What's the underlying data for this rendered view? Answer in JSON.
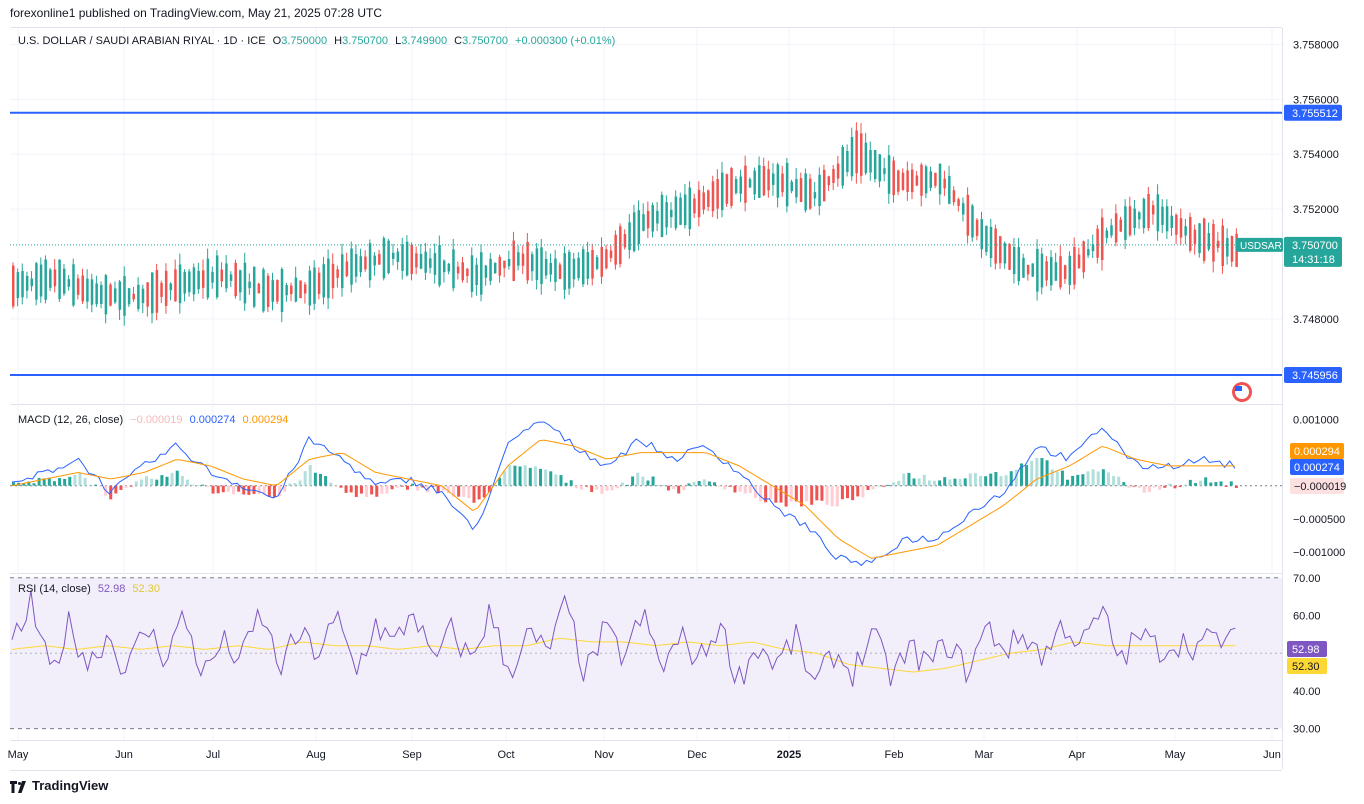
{
  "header": {
    "text": "forexonline1 published on TradingView.com, May 21, 2025 07:28 UTC"
  },
  "legend": {
    "symbol": "U.S. DOLLAR / SAUDI ARABIAN RIYAL · 1D · ICE",
    "o_label": "O",
    "o": "3.750000",
    "h_label": "H",
    "h": "3.750700",
    "l_label": "L",
    "l": "3.749900",
    "c_label": "C",
    "c": "3.750700",
    "change": "+0.000300 (+0.01%)"
  },
  "macd_legend": {
    "label": "MACD (12, 26, close)",
    "hist": "−0.000019",
    "macd": "0.000274",
    "signal": "0.000294"
  },
  "rsi_legend": {
    "label": "RSI (14, close)",
    "rsi": "52.98",
    "ma": "52.30"
  },
  "footer": {
    "brand": "TradingView"
  },
  "colors": {
    "up": "#26a69a",
    "down": "#ef5350",
    "hline": "#2962ff",
    "macd": "#2962ff",
    "signal": "#ff9800",
    "rsi": "#7e57c2",
    "rsi_ma": "#fdd835",
    "rsi_band": "#f2effb"
  },
  "chart_data": [
    {
      "type": "candlestick",
      "title": "U.S. DOLLAR / SAUDI ARABIAN RIYAL · 1D · ICE",
      "ylim": [
        3.7449,
        3.7586
      ],
      "yticks": [
        "3.758000",
        "3.756000",
        "3.754000",
        "3.752000",
        "3.748000"
      ],
      "xticks": [
        "May",
        "Jun",
        "Jul",
        "Aug",
        "Sep",
        "Oct",
        "Nov",
        "Dec",
        "2025",
        "Feb",
        "Mar",
        "Apr",
        "May",
        "Jun"
      ],
      "hlines": [
        {
          "value": 3.755512,
          "label": "3.755512"
        },
        {
          "value": 3.745956,
          "label": "3.745956"
        }
      ],
      "last_price": {
        "symbol": "USDSAR",
        "value": 3.7507,
        "label": "3.750700",
        "countdown": "14:31:18"
      },
      "trend": [
        3.7492,
        3.7495,
        3.7489,
        3.7488,
        3.7493,
        3.7496,
        3.749,
        3.7491,
        3.7499,
        3.7503,
        3.75,
        3.7496,
        3.7502,
        3.7497,
        3.7501,
        3.7516,
        3.752,
        3.7528,
        3.7531,
        3.7525,
        3.7541,
        3.753,
        3.7531,
        3.751,
        3.7498,
        3.7497,
        3.7512,
        3.752,
        3.751,
        3.7505
      ]
    },
    {
      "type": "macd",
      "title": "MACD (12, 26, close)",
      "ylim": [
        -0.00132,
        0.00122
      ],
      "yticks": [
        "0.001000",
        "−0.000500",
        "−0.001000"
      ],
      "macd": 0.000274,
      "signal": 0.000294,
      "histogram": -1.9e-05,
      "macd_trend": [
        0.0,
        0.0002,
        0.0004,
        -0.0001,
        0.0003,
        0.0006,
        0.0002,
        0.0,
        -0.0002,
        0.0007,
        0.0004,
        0.0,
        0.0001,
        -0.0001,
        -0.0007,
        0.0006,
        0.001,
        0.0006,
        0.0003,
        0.0007,
        0.0004,
        0.0006,
        0.0002,
        -0.0003,
        -0.0006,
        -0.0011,
        -0.0012,
        -0.0008,
        -0.0008,
        -0.0004,
        -0.0001,
        0.0006,
        0.0004,
        0.0009,
        0.0003,
        0.0003,
        0.0004,
        0.0003
      ],
      "signal_trend": [
        0.0,
        0.0001,
        0.0002,
        0.0001,
        0.0002,
        0.0004,
        0.0003,
        0.0001,
        0.0,
        0.0004,
        0.0005,
        0.0002,
        0.0001,
        0.0,
        -0.0004,
        0.0003,
        0.0007,
        0.0006,
        0.0004,
        0.0005,
        0.0005,
        0.0005,
        0.0003,
        0.0,
        -0.0003,
        -0.0008,
        -0.0011,
        -0.001,
        -0.0009,
        -0.0006,
        -0.0003,
        0.0001,
        0.0003,
        0.0006,
        0.0004,
        0.0003,
        0.0003,
        0.0003
      ]
    },
    {
      "type": "rsi",
      "title": "RSI (14, close)",
      "ylim": [
        27,
        71
      ],
      "yticks": [
        "70.00",
        "60.00",
        "40.00",
        "30.00"
      ],
      "bands": [
        70,
        30
      ],
      "mid": 50,
      "rsi": 52.98,
      "rsi_ma": 52.3,
      "rsi_trend": [
        52,
        63,
        44,
        58,
        47,
        55,
        45,
        57,
        49,
        60,
        44,
        53,
        48,
        61,
        46,
        55,
        50,
        59,
        45,
        58,
        52,
        62,
        47,
        56,
        48,
        61,
        45,
        55,
        50,
        63,
        44,
        56,
        49,
        60,
        46,
        54,
        48,
        58,
        43,
        52,
        47,
        54,
        41,
        50,
        45,
        55,
        44,
        51,
        47,
        53,
        45,
        57,
        51,
        55,
        49,
        58,
        52,
        61,
        48,
        55,
        51,
        53,
        52,
        54,
        53
      ],
      "ma_trend": [
        51,
        52,
        51,
        52,
        51,
        52,
        51,
        52,
        51,
        53,
        52,
        52,
        51,
        52,
        51,
        52,
        52,
        54,
        53,
        53,
        52,
        53,
        52,
        53,
        51,
        50,
        47,
        46,
        45,
        46,
        48,
        50,
        51,
        53,
        52,
        52,
        52,
        52,
        52
      ]
    }
  ]
}
